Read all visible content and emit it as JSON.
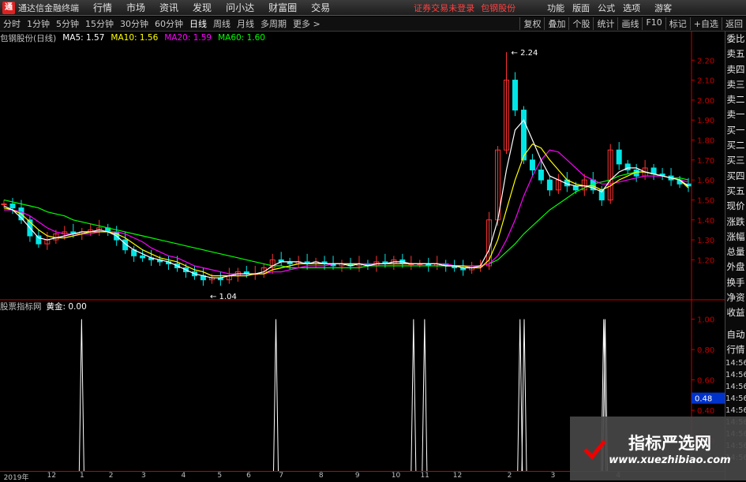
{
  "titlebar": {
    "logo_glyph": "通",
    "app_title": "通达信金融终端",
    "menu": [
      "行情",
      "市场",
      "资讯",
      "发现",
      "问小达",
      "财富圈",
      "交易"
    ],
    "notice": "证券交易未登录",
    "stock_link": "包钢股份",
    "right_menu": [
      "功能",
      "版面",
      "公式",
      "选项"
    ],
    "guest": "游客",
    "window_buttons": [
      "▭",
      "—",
      "□",
      "✕"
    ]
  },
  "toolbar": {
    "periods": [
      "分时",
      "1分钟",
      "5分钟",
      "15分钟",
      "30分钟",
      "60分钟",
      "日线",
      "周线",
      "月线",
      "多周期",
      "更多 >"
    ],
    "active_period": "日线",
    "buttons": [
      "复权",
      "叠加",
      "个股",
      "统计",
      "画线",
      "F10",
      "标记",
      "+自选",
      "返回"
    ]
  },
  "ma_bar": {
    "stock": "包钢股份(日线)",
    "ma5": "MA5: 1.57",
    "ma10": "MA10: 1.56",
    "ma20": "MA20: 1.59",
    "ma60": "MA60: 1.60",
    "colors": {
      "ma5": "#ffffff",
      "ma10": "#ffff00",
      "ma20": "#ff00ff",
      "ma60": "#00ff00"
    }
  },
  "indicator_bar": {
    "name": "股票指标网",
    "label": "黄金: 0.00",
    "current_value": "0.48"
  },
  "side_tabs": [
    "委比",
    "卖五",
    "卖四",
    "卖三",
    "卖二",
    "卖一",
    "买一",
    "买二",
    "买三",
    "买四",
    "买五",
    "现价",
    "涨跌",
    "涨幅",
    "总量",
    "外盘",
    "换手",
    "净资",
    "收益"
  ],
  "side_tabs_lower": [
    "自动",
    "行情",
    "14:56",
    "14:56",
    "14:56",
    "14:56",
    "14:56",
    "14:56",
    "14:56",
    "14:56",
    "14:56"
  ],
  "dates": [
    {
      "t": "2019年",
      "x": 0.005
    },
    {
      "t": "12",
      "x": 0.065
    },
    {
      "t": "1",
      "x": 0.11
    },
    {
      "t": "2",
      "x": 0.15
    },
    {
      "t": "3",
      "x": 0.195
    },
    {
      "t": "4",
      "x": 0.25
    },
    {
      "t": "5",
      "x": 0.3
    },
    {
      "t": "6",
      "x": 0.34
    },
    {
      "t": "7",
      "x": 0.385
    },
    {
      "t": "8",
      "x": 0.44
    },
    {
      "t": "9",
      "x": 0.49
    },
    {
      "t": "10",
      "x": 0.54
    },
    {
      "t": "11",
      "x": 0.58
    },
    {
      "t": "12",
      "x": 0.625
    },
    {
      "t": "2",
      "x": 0.7
    },
    {
      "t": "3",
      "x": 0.76
    },
    {
      "t": "4",
      "x": 0.85
    }
  ],
  "watermark": {
    "title": "指标严选网",
    "url": "www.xuezhibiao.com"
  },
  "chart_data": [
    {
      "type": "candlestick",
      "title": "包钢股份(日线)",
      "y_ticks": [
        1.2,
        1.3,
        1.4,
        1.5,
        1.6,
        1.7,
        1.8,
        1.9,
        2.0,
        2.1,
        2.2
      ],
      "ylim": [
        1.0,
        2.28
      ],
      "high_marker": "2.24",
      "low_marker": "1.04",
      "close_path": [
        1.48,
        1.46,
        1.4,
        1.32,
        1.28,
        1.3,
        1.33,
        1.34,
        1.33,
        1.34,
        1.35,
        1.36,
        1.34,
        1.3,
        1.25,
        1.22,
        1.21,
        1.2,
        1.19,
        1.18,
        1.16,
        1.14,
        1.12,
        1.1,
        1.11,
        1.1,
        1.12,
        1.14,
        1.13,
        1.13,
        1.16,
        1.2,
        1.19,
        1.18,
        1.19,
        1.18,
        1.19,
        1.18,
        1.17,
        1.18,
        1.17,
        1.18,
        1.17,
        1.19,
        1.18,
        1.2,
        1.18,
        1.18,
        1.18,
        1.17,
        1.18,
        1.17,
        1.16,
        1.15,
        1.17,
        1.17,
        1.4,
        1.75,
        2.1,
        1.95,
        1.7,
        1.65,
        1.6,
        1.55,
        1.6,
        1.57,
        1.55,
        1.6,
        1.55,
        1.5,
        1.75,
        1.68,
        1.65,
        1.62,
        1.66,
        1.63,
        1.62,
        1.6,
        1.58,
        1.57
      ],
      "ma5": [
        1.47,
        1.45,
        1.41,
        1.36,
        1.31,
        1.3,
        1.31,
        1.32,
        1.33,
        1.34,
        1.34,
        1.35,
        1.34,
        1.32,
        1.28,
        1.25,
        1.23,
        1.21,
        1.2,
        1.19,
        1.17,
        1.15,
        1.13,
        1.12,
        1.11,
        1.11,
        1.12,
        1.13,
        1.13,
        1.13,
        1.14,
        1.17,
        1.19,
        1.19,
        1.19,
        1.18,
        1.19,
        1.18,
        1.18,
        1.18,
        1.17,
        1.18,
        1.17,
        1.18,
        1.18,
        1.19,
        1.19,
        1.18,
        1.18,
        1.18,
        1.18,
        1.17,
        1.17,
        1.16,
        1.16,
        1.17,
        1.25,
        1.4,
        1.65,
        1.85,
        1.9,
        1.8,
        1.7,
        1.62,
        1.6,
        1.58,
        1.57,
        1.57,
        1.56,
        1.54,
        1.6,
        1.64,
        1.66,
        1.66,
        1.64,
        1.63,
        1.62,
        1.61,
        1.6,
        1.57
      ],
      "ma10": [
        1.46,
        1.45,
        1.43,
        1.39,
        1.35,
        1.32,
        1.31,
        1.31,
        1.32,
        1.33,
        1.34,
        1.34,
        1.34,
        1.33,
        1.31,
        1.28,
        1.25,
        1.23,
        1.21,
        1.2,
        1.19,
        1.17,
        1.15,
        1.14,
        1.12,
        1.12,
        1.12,
        1.12,
        1.12,
        1.13,
        1.13,
        1.15,
        1.16,
        1.17,
        1.18,
        1.18,
        1.18,
        1.18,
        1.18,
        1.18,
        1.18,
        1.18,
        1.17,
        1.18,
        1.18,
        1.18,
        1.18,
        1.18,
        1.18,
        1.18,
        1.18,
        1.17,
        1.17,
        1.17,
        1.16,
        1.16,
        1.2,
        1.3,
        1.45,
        1.6,
        1.72,
        1.78,
        1.76,
        1.7,
        1.65,
        1.6,
        1.58,
        1.57,
        1.57,
        1.55,
        1.57,
        1.6,
        1.62,
        1.64,
        1.64,
        1.63,
        1.62,
        1.61,
        1.6,
        1.56
      ],
      "ma20": [
        1.45,
        1.45,
        1.44,
        1.42,
        1.39,
        1.36,
        1.34,
        1.33,
        1.33,
        1.33,
        1.33,
        1.34,
        1.34,
        1.34,
        1.33,
        1.31,
        1.29,
        1.26,
        1.24,
        1.22,
        1.21,
        1.19,
        1.17,
        1.16,
        1.15,
        1.14,
        1.13,
        1.13,
        1.13,
        1.13,
        1.13,
        1.14,
        1.14,
        1.15,
        1.16,
        1.17,
        1.17,
        1.17,
        1.18,
        1.18,
        1.18,
        1.18,
        1.18,
        1.18,
        1.18,
        1.18,
        1.18,
        1.18,
        1.18,
        1.18,
        1.18,
        1.18,
        1.17,
        1.17,
        1.17,
        1.17,
        1.18,
        1.22,
        1.3,
        1.4,
        1.52,
        1.62,
        1.7,
        1.75,
        1.74,
        1.7,
        1.66,
        1.62,
        1.6,
        1.58,
        1.58,
        1.59,
        1.6,
        1.61,
        1.62,
        1.62,
        1.62,
        1.61,
        1.6,
        1.59
      ],
      "ma60": [
        1.5,
        1.49,
        1.48,
        1.47,
        1.46,
        1.44,
        1.43,
        1.42,
        1.4,
        1.39,
        1.38,
        1.37,
        1.36,
        1.35,
        1.34,
        1.33,
        1.32,
        1.31,
        1.3,
        1.29,
        1.28,
        1.27,
        1.26,
        1.25,
        1.24,
        1.23,
        1.22,
        1.21,
        1.2,
        1.19,
        1.18,
        1.17,
        1.17,
        1.16,
        1.16,
        1.16,
        1.16,
        1.16,
        1.16,
        1.16,
        1.16,
        1.16,
        1.17,
        1.17,
        1.17,
        1.17,
        1.17,
        1.17,
        1.17,
        1.17,
        1.17,
        1.17,
        1.17,
        1.17,
        1.17,
        1.17,
        1.18,
        1.2,
        1.24,
        1.28,
        1.33,
        1.37,
        1.41,
        1.45,
        1.48,
        1.51,
        1.54,
        1.56,
        1.58,
        1.59,
        1.6,
        1.62,
        1.63,
        1.64,
        1.64,
        1.63,
        1.62,
        1.61,
        1.61,
        1.6
      ],
      "up_color": "#ff3232",
      "down_color": "#00e6e6"
    },
    {
      "type": "bar",
      "title": "股票指标网",
      "series": [
        {
          "name": "黄金",
          "values": [
            1,
            1,
            1,
            1,
            1,
            1,
            1,
            1
          ]
        }
      ],
      "x_fraction": [
        0.118,
        0.399,
        0.598,
        0.614,
        0.752,
        0.758,
        0.873,
        0.875
      ],
      "y_ticks": [
        0.2,
        0.4,
        0.6,
        0.8,
        1.0
      ],
      "ylim": [
        0,
        1.05
      ],
      "color": "#ffffff"
    }
  ]
}
